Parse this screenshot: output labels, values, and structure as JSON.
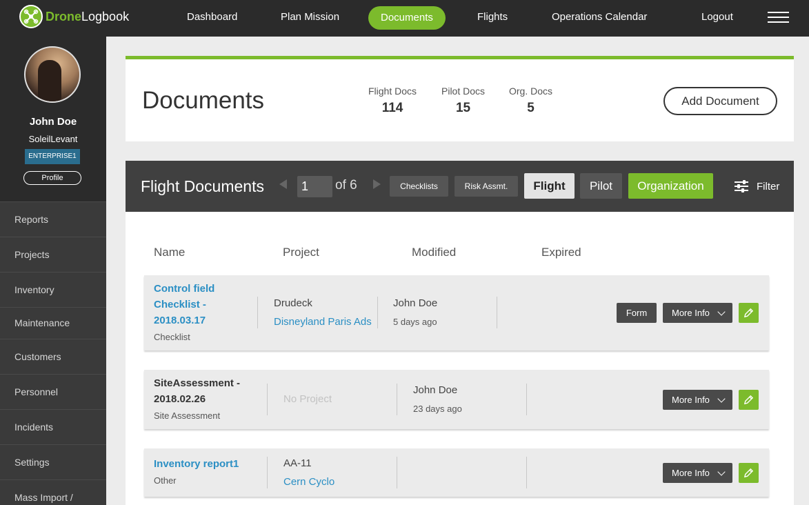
{
  "app": {
    "logo_primary": "Drone",
    "logo_secondary": "Logbook",
    "accent_color": "#7cbb2c"
  },
  "nav": {
    "items": [
      {
        "label": "Dashboard"
      },
      {
        "label": "Plan Mission"
      },
      {
        "label": "Documents",
        "active": true
      },
      {
        "label": "Flights"
      },
      {
        "label": "Operations Calendar"
      },
      {
        "label": "Logout"
      }
    ],
    "menu_icon": "hamburger-icon"
  },
  "profile": {
    "name": "John Doe",
    "organization": "SoleilLevant",
    "plan": "ENTERPRISE1",
    "profile_label": "Profile"
  },
  "sidebar": {
    "items": [
      {
        "label": "Reports"
      },
      {
        "label": "Projects"
      },
      {
        "label": "Inventory"
      },
      {
        "label": "Maintenance"
      },
      {
        "label": "Customers"
      },
      {
        "label": "Personnel"
      },
      {
        "label": "Incidents"
      },
      {
        "label": "Settings"
      },
      {
        "label": "Mass Import /"
      }
    ]
  },
  "header": {
    "title": "Documents",
    "stats": [
      {
        "label": "Flight Docs",
        "value": "114"
      },
      {
        "label": "Pilot Docs",
        "value": "15"
      },
      {
        "label": "Org. Docs",
        "value": "5"
      }
    ],
    "add_label": "Add Document"
  },
  "panel": {
    "title": "Flight Documents",
    "page_value": "1",
    "page_of": "of 6",
    "chips": {
      "checklists": "Checklists",
      "risk": "Risk Assmt.",
      "flight": "Flight",
      "pilot": "Pilot",
      "organization": "Organization"
    },
    "active_tab": "Flight",
    "filter_label": "Filter"
  },
  "columns": {
    "name": "Name",
    "project": "Project",
    "modified": "Modified",
    "expired": "Expired"
  },
  "rows": [
    {
      "name_lines": [
        "Control field",
        "Checklist -",
        "2018.03.17"
      ],
      "type": "Checklist",
      "project_code": "Drudeck",
      "project_name": "Disneyland Paris Ads",
      "modified_by": "John Doe",
      "modified_ago": "5 days ago",
      "form_label": "Form",
      "more_label": "More Info"
    },
    {
      "name_lines": [
        "SiteAssessment -",
        "2018.02.26"
      ],
      "type": "Site Assessment",
      "project_none": "No Project",
      "modified_by": "John Doe",
      "modified_ago": "23 days ago",
      "more_label": "More Info"
    },
    {
      "name_lines": [
        "Inventory report1"
      ],
      "type": "Other",
      "project_code": "AA-11",
      "project_name": "Cern Cyclo",
      "more_label": "More Info"
    }
  ]
}
